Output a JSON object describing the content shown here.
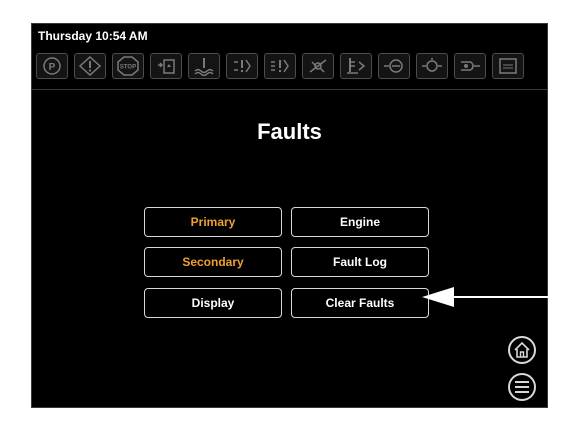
{
  "header": {
    "datetime": "Thursday 10:54 AM"
  },
  "status_icons": [
    "parking-brake-icon",
    "warning-icon",
    "stop-icon",
    "coolant-level-icon",
    "coolant-temp-icon",
    "fault-icon-1",
    "fault-icon-2",
    "fault-icon-3",
    "fuel-level-icon",
    "water-in-fuel-icon",
    "oil-pressure-icon",
    "glow-plug-icon",
    "emissions-icon"
  ],
  "page": {
    "title": "Faults"
  },
  "menu": {
    "primary": "Primary",
    "engine": "Engine",
    "secondary": "Secondary",
    "fault_log": "Fault Log",
    "display": "Display",
    "clear_faults": "Clear Faults"
  },
  "colors": {
    "accent": "#f0a030",
    "text": "#ffffff",
    "icon_gray": "#7a7a7a",
    "background": "#000000"
  }
}
